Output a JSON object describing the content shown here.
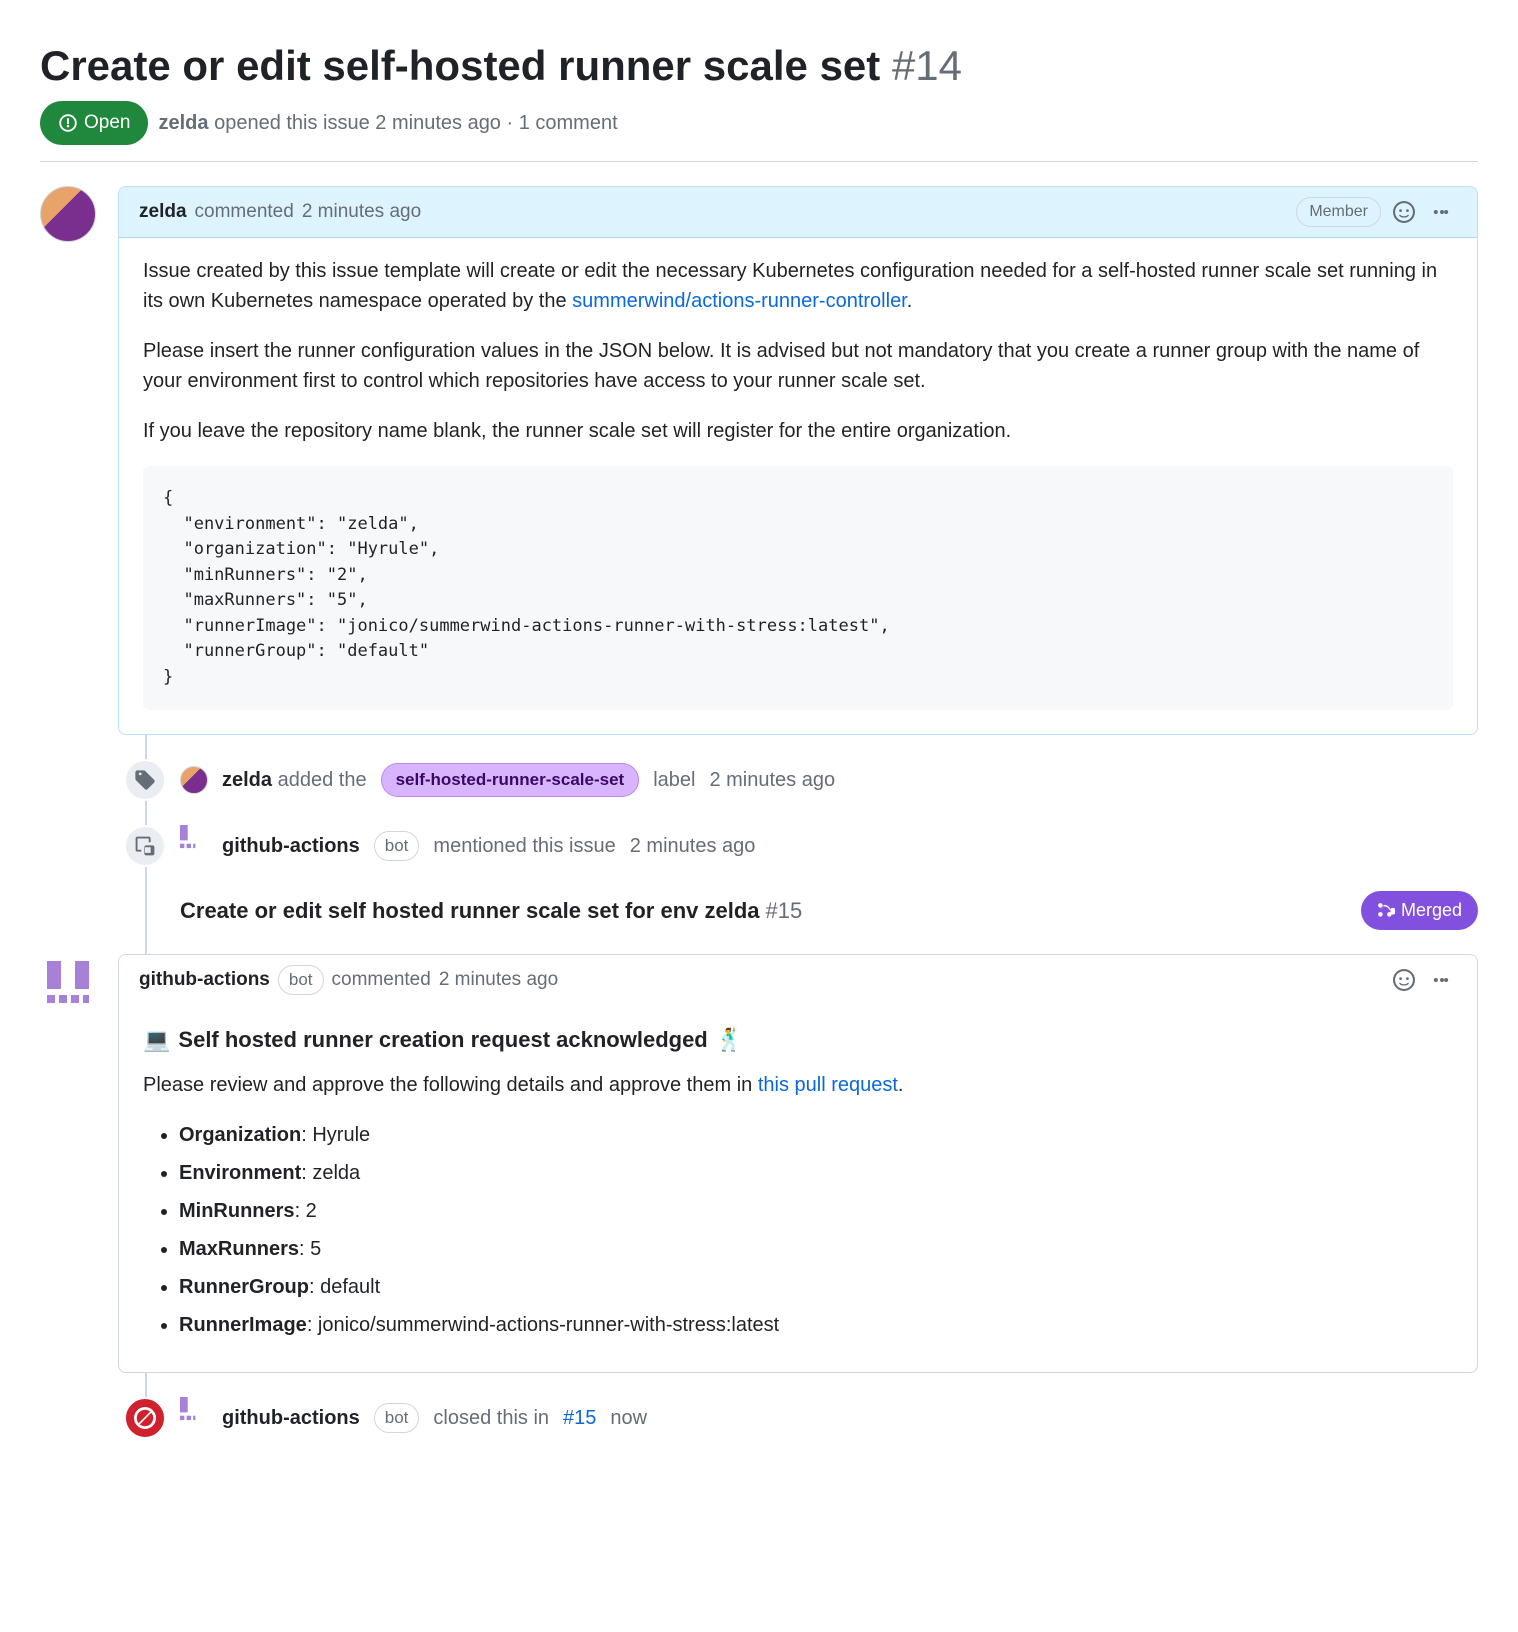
{
  "issue": {
    "title": "Create or edit self-hosted runner scale set",
    "number": "#14",
    "state": "Open",
    "author": "zelda",
    "opened_text": "opened this issue 2 minutes ago · 1 comment"
  },
  "comment1": {
    "author": "zelda",
    "action": "commented",
    "time": "2 minutes ago",
    "badge": "Member",
    "p1a": "Issue created by this issue template will create or edit the necessary Kubernetes configuration needed for a self-hosted runner scale set running in its own Kubernetes namespace operated by the ",
    "link_text": "summerwind/actions-runner-controller",
    "p1b": ".",
    "p2": "Please insert the runner configuration values in the JSON below. It is advised but not mandatory that you create a runner group with the name of your environment first to control which repositories have access to your runner scale set.",
    "p3": "If you leave the repository name blank, the runner scale set will register for the entire organization.",
    "code": "{\n  \"environment\": \"zelda\",\n  \"organization\": \"Hyrule\",\n  \"minRunners\": \"2\",\n  \"maxRunners\": \"5\",\n  \"runnerImage\": \"jonico/summerwind-actions-runner-with-stress:latest\",\n  \"runnerGroup\": \"default\"\n}"
  },
  "event_label": {
    "author": "zelda",
    "pre": "added the",
    "label": "self-hosted-runner-scale-set",
    "post": "label",
    "time": "2 minutes ago"
  },
  "event_ref": {
    "author": "github-actions",
    "bot": "bot",
    "action": "mentioned this issue",
    "time": "2 minutes ago",
    "ref_title": "Create or edit self hosted runner scale set for env zelda",
    "ref_num": "#15",
    "merged": "Merged"
  },
  "comment2": {
    "author": "github-actions",
    "bot": "bot",
    "action": "commented",
    "time": "2 minutes ago",
    "heading": "Self hosted runner creation request acknowledged",
    "p1a": "Please review and approve the following details and approve them in ",
    "link": "this pull request",
    "p1b": ".",
    "li1k": "Organization",
    "li1v": ": Hyrule",
    "li2k": "Environment",
    "li2v": ": zelda",
    "li3k": "MinRunners",
    "li3v": ": 2",
    "li4k": "MaxRunners",
    "li4v": ": 5",
    "li5k": "RunnerGroup",
    "li5v": ": default",
    "li6k": "RunnerImage",
    "li6v": ": jonico/summerwind-actions-runner-with-stress:latest"
  },
  "event_close": {
    "author": "github-actions",
    "bot": "bot",
    "pre": "closed this in",
    "ref": "#15",
    "time": "now"
  }
}
